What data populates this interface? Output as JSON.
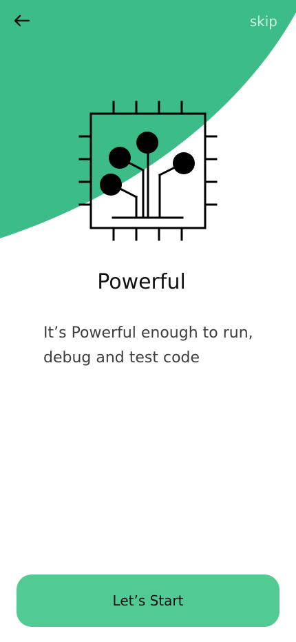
{
  "header": {
    "back_icon": "arrow-left-icon",
    "skip_label": "skip"
  },
  "onboarding": {
    "illustration_icon": "processor-chip-icon",
    "title": "Powerful",
    "description": "It’s Powerful enough to run, debug and test code"
  },
  "cta": {
    "label": "Let’s Start"
  },
  "colors": {
    "hero_background": "#3CBC87",
    "button_background": "#51CB93",
    "title_text": "#111111",
    "body_text": "#3D3D3D"
  }
}
